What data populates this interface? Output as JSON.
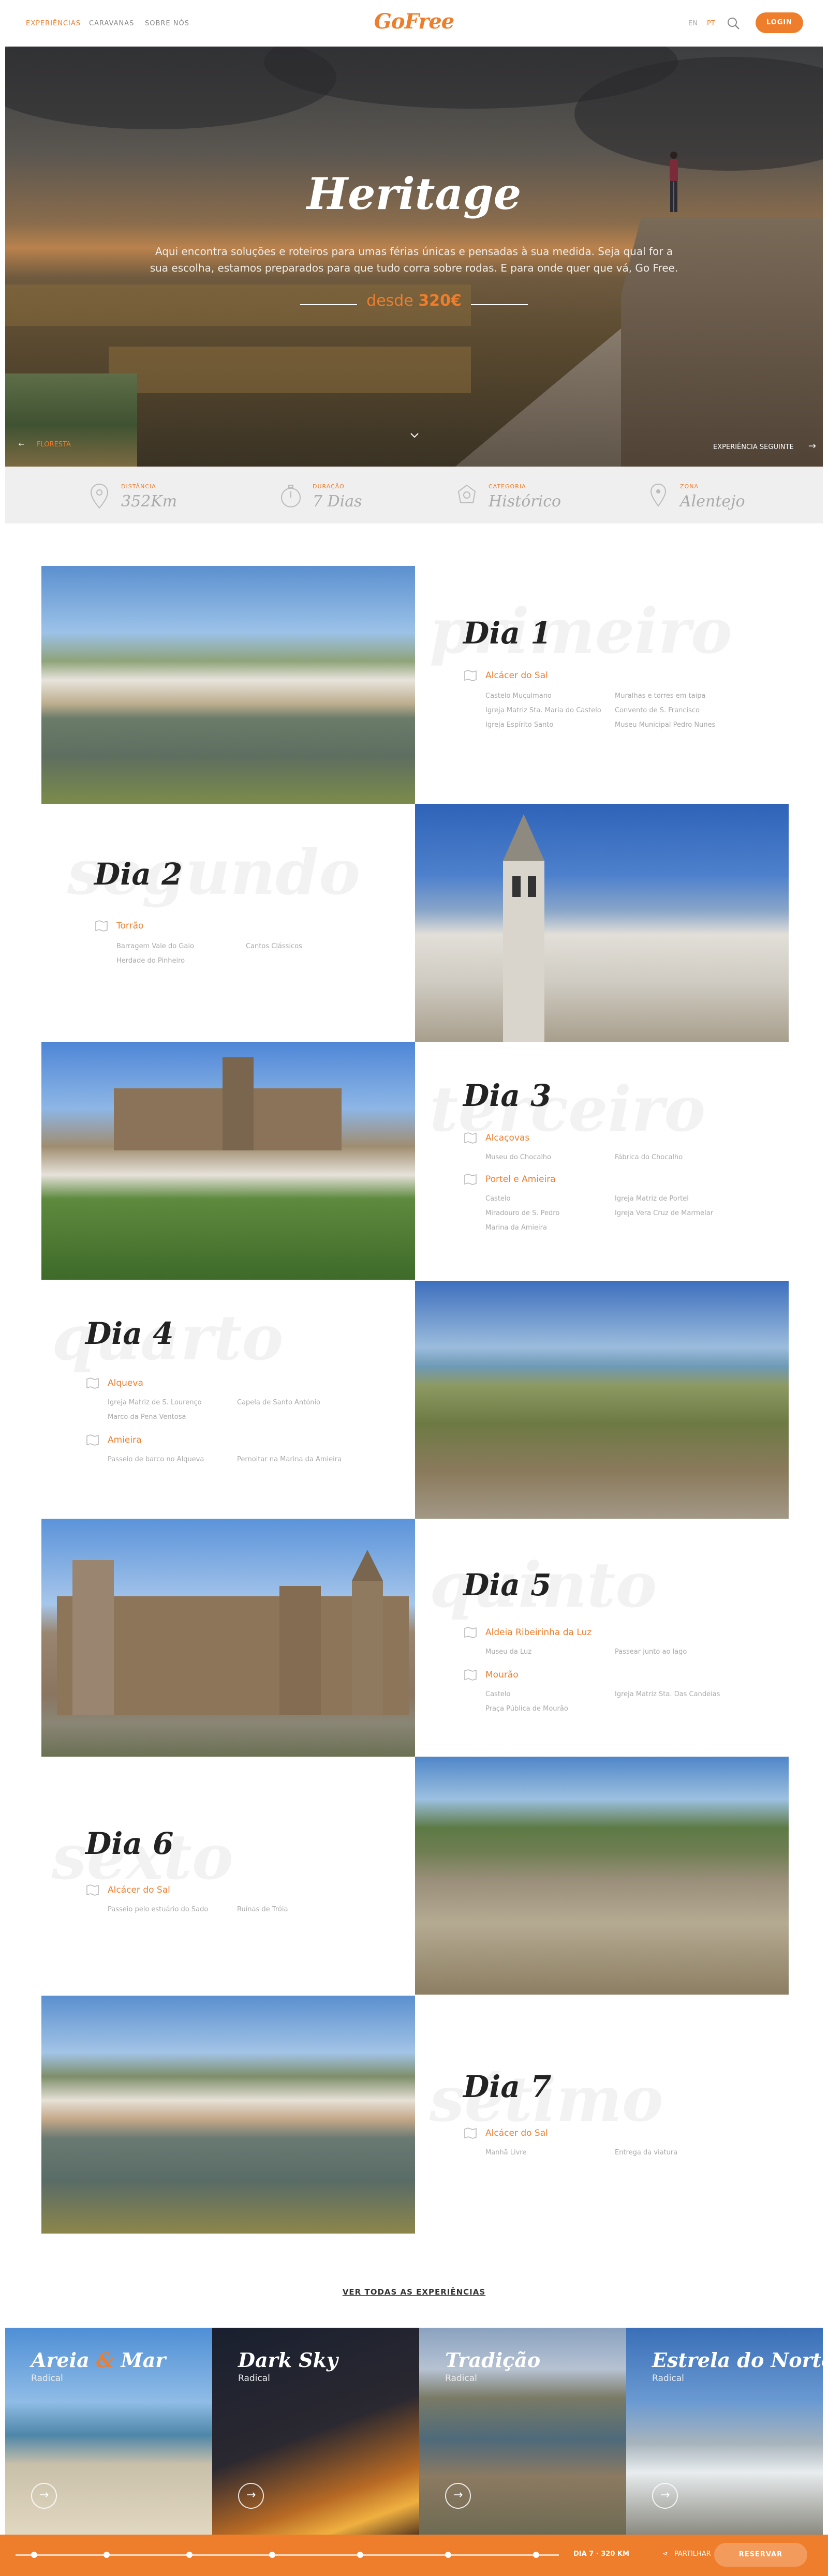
{
  "header": {
    "nav": [
      "EXPERIÊNCIAS",
      "CARAVANAS",
      "SOBRE NÓS"
    ],
    "logo": "GoFree",
    "lang": [
      "EN",
      "PT"
    ],
    "login": "LOGIN",
    "accent_color": "#ee7d2c"
  },
  "hero": {
    "title": "Heritage",
    "description": "Aqui encontra soluções e roteiros para umas férias únicas e pensadas à sua medida. Seja qual for a sua escolha, estamos preparados para que tudo corra sobre rodas. E para onde quer que vá, Go Free.",
    "price_prefix": "desde",
    "price": "320€",
    "prev_label": "FLORESTA",
    "next_label": "EXPERIÊNCIA SEGUINTE"
  },
  "info": [
    {
      "label": "DISTÂNCIA",
      "value": "352Km",
      "icon": "map-pin-icon"
    },
    {
      "label": "DURAÇÃO",
      "value": "7 Dias",
      "icon": "stopwatch-icon"
    },
    {
      "label": "CATEGORIA",
      "value": "Histórico",
      "icon": "category-badge-icon"
    },
    {
      "label": "ZONA",
      "value": "Alentejo",
      "icon": "location-icon"
    }
  ],
  "days": [
    {
      "ghost": "primeiro",
      "title": "Dia 1",
      "places": [
        {
          "name": "Alcácer do Sal",
          "pois": [
            "Castelo Muçulmano",
            "Muralhas e torres em taipa",
            "Igreja Matriz Sta. Maria do Castelo",
            "Convento de S. Francisco",
            "Igreja Espírito Santo",
            "Museu Municipal Pedro Nunes"
          ]
        }
      ]
    },
    {
      "ghost": "segundo",
      "title": "Dia 2",
      "places": [
        {
          "name": "Torrão",
          "pois": [
            "Barragem Vale do Gaio",
            "Cantos Clássicos",
            "Herdade do Pinheiro"
          ]
        }
      ]
    },
    {
      "ghost": "terceiro",
      "title": "Dia 3",
      "places": [
        {
          "name": "Alcaçovas",
          "pois": [
            "Museu do Chocalho",
            "Fábrica do Chocalho"
          ]
        },
        {
          "name": "Portel e Amieira",
          "pois": [
            "Castelo",
            "Igreja Matriz de Portel",
            "Miradouro de S. Pedro",
            "Igreja Vera Cruz de Marmelar",
            "Marina da Amieira"
          ]
        }
      ]
    },
    {
      "ghost": "quarto",
      "title": "Dia 4",
      "places": [
        {
          "name": "Alqueva",
          "pois": [
            "Igreja Matriz de S. Lourenço",
            "Capela de Santo António",
            "Marco da Pena Ventosa"
          ]
        },
        {
          "name": "Amieira",
          "pois": [
            "Passeio de barco no Alqueva",
            "Pernoitar na Marina da Amieira"
          ]
        }
      ]
    },
    {
      "ghost": "quinto",
      "title": "Dia 5",
      "places": [
        {
          "name": "Aldeia Ribeirinha da Luz",
          "pois": [
            "Museu da Luz",
            "Passear junto ao lago"
          ]
        },
        {
          "name": "Mourão",
          "pois": [
            "Castelo",
            "Igreja Matriz Sta. Das Candeias",
            "Praça Pública de Mourão"
          ]
        }
      ]
    },
    {
      "ghost": "sexto",
      "title": "Dia 6",
      "places": [
        {
          "name": "Alcácer do Sal",
          "pois": [
            "Passeio pelo estuário do Sado",
            "Ruínas de Tróia"
          ]
        }
      ]
    },
    {
      "ghost": "sétimo",
      "title": "Dia 7",
      "places": [
        {
          "name": "Alcácer do Sal",
          "pois": [
            "Manhã Livre",
            "Entrega da viatura"
          ]
        }
      ]
    }
  ],
  "see_all": "VER TODAS AS EXPERIÊNCIAS",
  "experiences": [
    {
      "title_a": "Areia",
      "amp": "&",
      "title_b": "Mar",
      "sub": "Radical"
    },
    {
      "title": "Dark Sky",
      "sub": "Radical"
    },
    {
      "title": "Tradição",
      "sub": "Radical"
    },
    {
      "title": "Estrela do Norte",
      "sub": "Radical"
    }
  ],
  "bottom": {
    "day": "DIA 7 · 320 KM",
    "share": "PARTILHAR",
    "reserve": "RESERVAR"
  }
}
